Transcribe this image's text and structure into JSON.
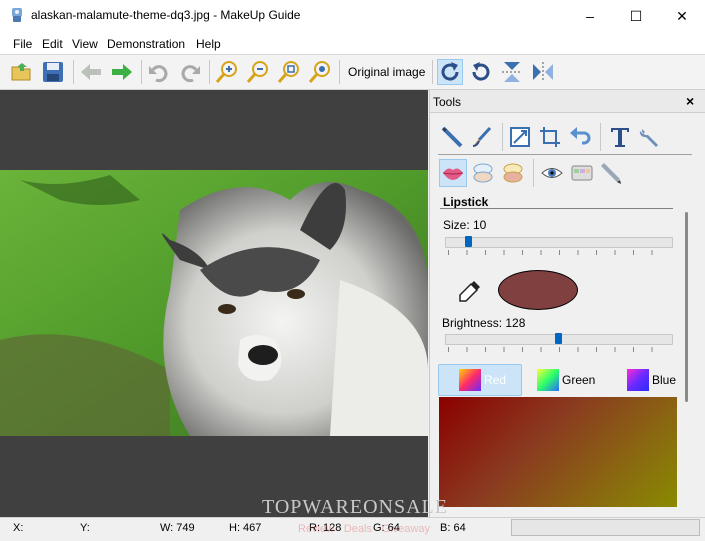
{
  "window": {
    "title": "alaskan-malamute-theme-dq3.jpg - MakeUp Guide",
    "minimize": "–",
    "maximize": "☐",
    "close": "✕"
  },
  "menu": [
    "File",
    "Edit",
    "View",
    "Demonstration",
    "Help"
  ],
  "toolbar": {
    "original_label": "Original image",
    "icons": [
      "open-icon",
      "save-icon",
      "back-icon",
      "forward-icon",
      "undo-icon",
      "redo-icon",
      "zoom-in-icon",
      "zoom-out-icon",
      "zoom-fit-icon",
      "zoom-actual-icon",
      "rotate-cw-icon",
      "rotate-ccw-icon",
      "flip-vertical-icon",
      "flip-horizontal-icon"
    ]
  },
  "tools_panel": {
    "title": "Tools",
    "close": "×",
    "section_title": "Lipstick",
    "size_label": "Size: 10",
    "size_value": 10,
    "brightness_label": "Brightness: 128",
    "brightness_value": 128,
    "swatch_color": "#804040",
    "tabs": [
      "Red",
      "Green",
      "Blue"
    ],
    "active_tab": "Red"
  },
  "status": {
    "x": "X:",
    "y": "Y:",
    "w": "W: 749",
    "h": "H: 467",
    "r": "R: 128",
    "g": "G: 64",
    "b": "B: 64"
  },
  "watermark": {
    "brand": "TOPWAREONSALE",
    "tagline": "Review · Deals · Giveaway"
  },
  "colors": {
    "accent": "#0067c0",
    "canvas_bg": "#404040",
    "tab_active_bg": "#cce4f7"
  }
}
